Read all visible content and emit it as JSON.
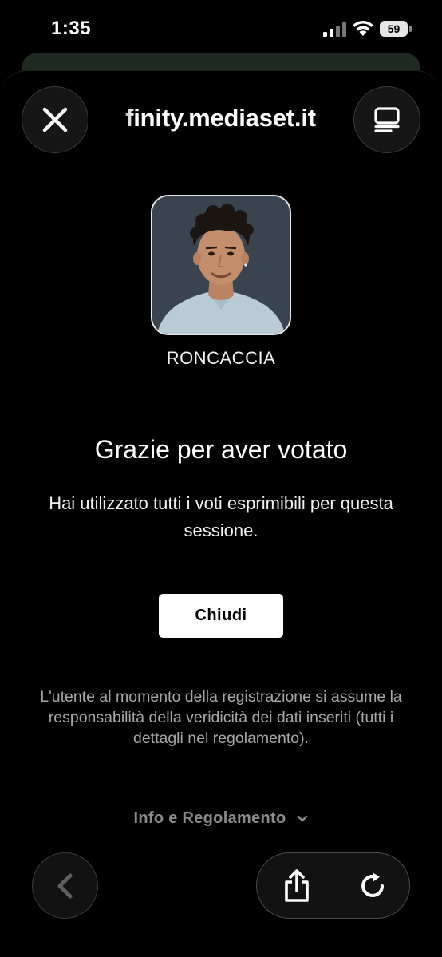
{
  "status_bar": {
    "time": "1:35",
    "battery_percent": "59"
  },
  "browser": {
    "url": "finity.mediaset.it",
    "close_icon": "close-icon",
    "tabs_icon": "tabs-icon"
  },
  "vote": {
    "candidate_name": "RONCACCIA",
    "thanks_title": "Grazie per aver votato",
    "message": "Hai utilizzato tutti i voti esprimibili per questa sessione.",
    "close_button_label": "Chiudi",
    "disclaimer": "L'utente al momento della registrazione si assume la responsabilità della veridicità dei dati inseriti (tutti i dettagli nel regolamento)."
  },
  "footer": {
    "info_link_label": "Info e Regolamento"
  },
  "toolbar": {
    "back_icon": "chevron-left-icon",
    "share_icon": "share-icon",
    "reload_icon": "reload-icon"
  }
}
